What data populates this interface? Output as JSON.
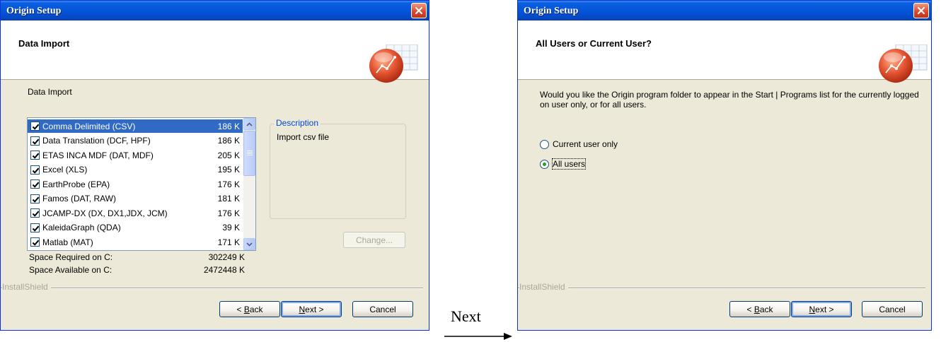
{
  "arrow_caption": "Next",
  "dialog1": {
    "title": "Origin Setup",
    "header_title": "Data Import",
    "section_label": "Data Import",
    "list_items": [
      {
        "name": "Comma Delimited (CSV)",
        "size": "186 K",
        "checked": true,
        "selected": true
      },
      {
        "name": "Data Translation (DCF, HPF)",
        "size": "186 K",
        "checked": true
      },
      {
        "name": "ETAS INCA MDF (DAT, MDF)",
        "size": "205 K",
        "checked": true
      },
      {
        "name": "Excel (XLS)",
        "size": "195 K",
        "checked": true
      },
      {
        "name": "EarthProbe (EPA)",
        "size": "176 K",
        "checked": true
      },
      {
        "name": "Famos (DAT, RAW)",
        "size": "181 K",
        "checked": true
      },
      {
        "name": "JCAMP-DX (DX, DX1,JDX, JCM)",
        "size": "176 K",
        "checked": true
      },
      {
        "name": "KaleidaGraph (QDA)",
        "size": "39 K",
        "checked": true
      },
      {
        "name": "Matlab (MAT)",
        "size": "171 K",
        "checked": true
      }
    ],
    "description_label": "Description",
    "description_text": "Import csv file",
    "change_label": "Change...",
    "space_required_label": "Space Required on  C:",
    "space_required_value": "302249 K",
    "space_available_label": "Space Available on  C:",
    "space_available_value": "2472448 K",
    "installshield": "InstallShield",
    "back_pre": "< ",
    "back_key": "B",
    "back_rest": "ack",
    "next_key": "N",
    "next_rest": "ext >",
    "cancel_label": "Cancel"
  },
  "dialog2": {
    "title": "Origin Setup",
    "header_title": "All Users or Current User?",
    "question": "Would you like the Origin program folder to appear in the Start | Programs list for the currently logged on user only, or for all users.",
    "option_current": "Current user only",
    "option_all": "All users",
    "selected_option": "All users",
    "installshield": "InstallShield",
    "back_pre": "< ",
    "back_key": "B",
    "back_rest": "ack",
    "next_key": "N",
    "next_rest": "ext >",
    "cancel_label": "Cancel"
  },
  "colors": {
    "title_bar": "#0554d8",
    "selection": "#316ac5",
    "dialog_bg": "#ece9d8",
    "description_legend": "#0046d5"
  },
  "icons": [
    "close-icon",
    "origin-logo-icon",
    "checkbox-icon",
    "scroll-up-icon",
    "scroll-down-icon",
    "radio-icon",
    "arrow-right-icon"
  ]
}
